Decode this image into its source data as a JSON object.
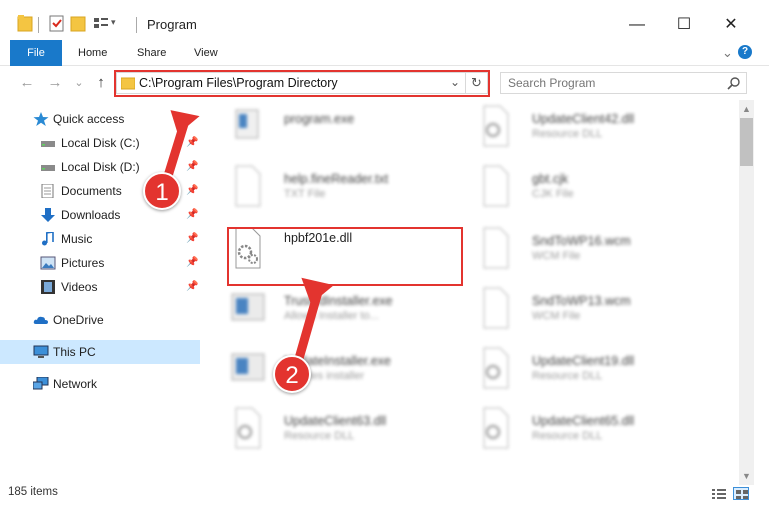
{
  "window": {
    "title": "Program",
    "controls": {
      "minimize": "—",
      "maximize": "☐",
      "close": "✕"
    }
  },
  "ribbon": {
    "tabs": [
      {
        "label": "File"
      },
      {
        "label": "Home"
      },
      {
        "label": "Share"
      },
      {
        "label": "View"
      }
    ],
    "expand": "⌄",
    "help": "?"
  },
  "nav": {
    "back": "←",
    "forward": "→",
    "recent": "⌄",
    "up": "↑",
    "address": "C:\\Program Files\\Program Directory",
    "address_dropdown": "⌄",
    "refresh": "↻",
    "search_placeholder": "Search Program"
  },
  "sidebar": {
    "items": [
      {
        "label": "Quick access",
        "icon": "star-icon"
      },
      {
        "label": "Local Disk (C:)",
        "icon": "drive-icon",
        "pinned": true
      },
      {
        "label": "Local Disk (D:)",
        "icon": "drive-icon",
        "pinned": true
      },
      {
        "label": "Documents",
        "icon": "documents-icon",
        "pinned": true
      },
      {
        "label": "Downloads",
        "icon": "download-icon",
        "pinned": true
      },
      {
        "label": "Music",
        "icon": "music-icon",
        "pinned": true
      },
      {
        "label": "Pictures",
        "icon": "pictures-icon",
        "pinned": true
      },
      {
        "label": "Videos",
        "icon": "videos-icon",
        "pinned": true
      },
      {
        "label": "OneDrive",
        "icon": "cloud-icon"
      },
      {
        "label": "This PC",
        "icon": "computer-icon",
        "selected": true
      },
      {
        "label": "Network",
        "icon": "network-icon"
      }
    ],
    "pin_glyph": "📌"
  },
  "files": {
    "left": [
      {
        "name": "program.exe",
        "type": ""
      },
      {
        "name": "help.fineReader.txt",
        "type": "TXT File"
      },
      {
        "name": "hpbf201e.dll",
        "type": ""
      },
      {
        "name": "TrustedInstaller.exe",
        "type": "Allows Installer to..."
      },
      {
        "name": "UpdateInstaller.exe",
        "type": "updates installer"
      },
      {
        "name": "UpdateClient63.dll",
        "type": "Resource DLL"
      }
    ],
    "right": [
      {
        "name": "UpdateClient42.dll",
        "type": "Resource DLL"
      },
      {
        "name": "gbt.cjk",
        "type": "CJK File"
      },
      {
        "name": "SndToWP16.wcm",
        "type": "WCM File"
      },
      {
        "name": "SndToWP13.wcm",
        "type": "WCM File"
      },
      {
        "name": "UpdateClient19.dll",
        "type": "Resource DLL"
      },
      {
        "name": "UpdateClient65.dll",
        "type": "Resource DLL"
      }
    ]
  },
  "status": {
    "items_count": "185 items"
  },
  "annotations": {
    "step1": "1",
    "step2": "2"
  },
  "colors": {
    "accent": "#1979ca",
    "highlight": "#e3342f",
    "selected": "#cce8ff"
  }
}
